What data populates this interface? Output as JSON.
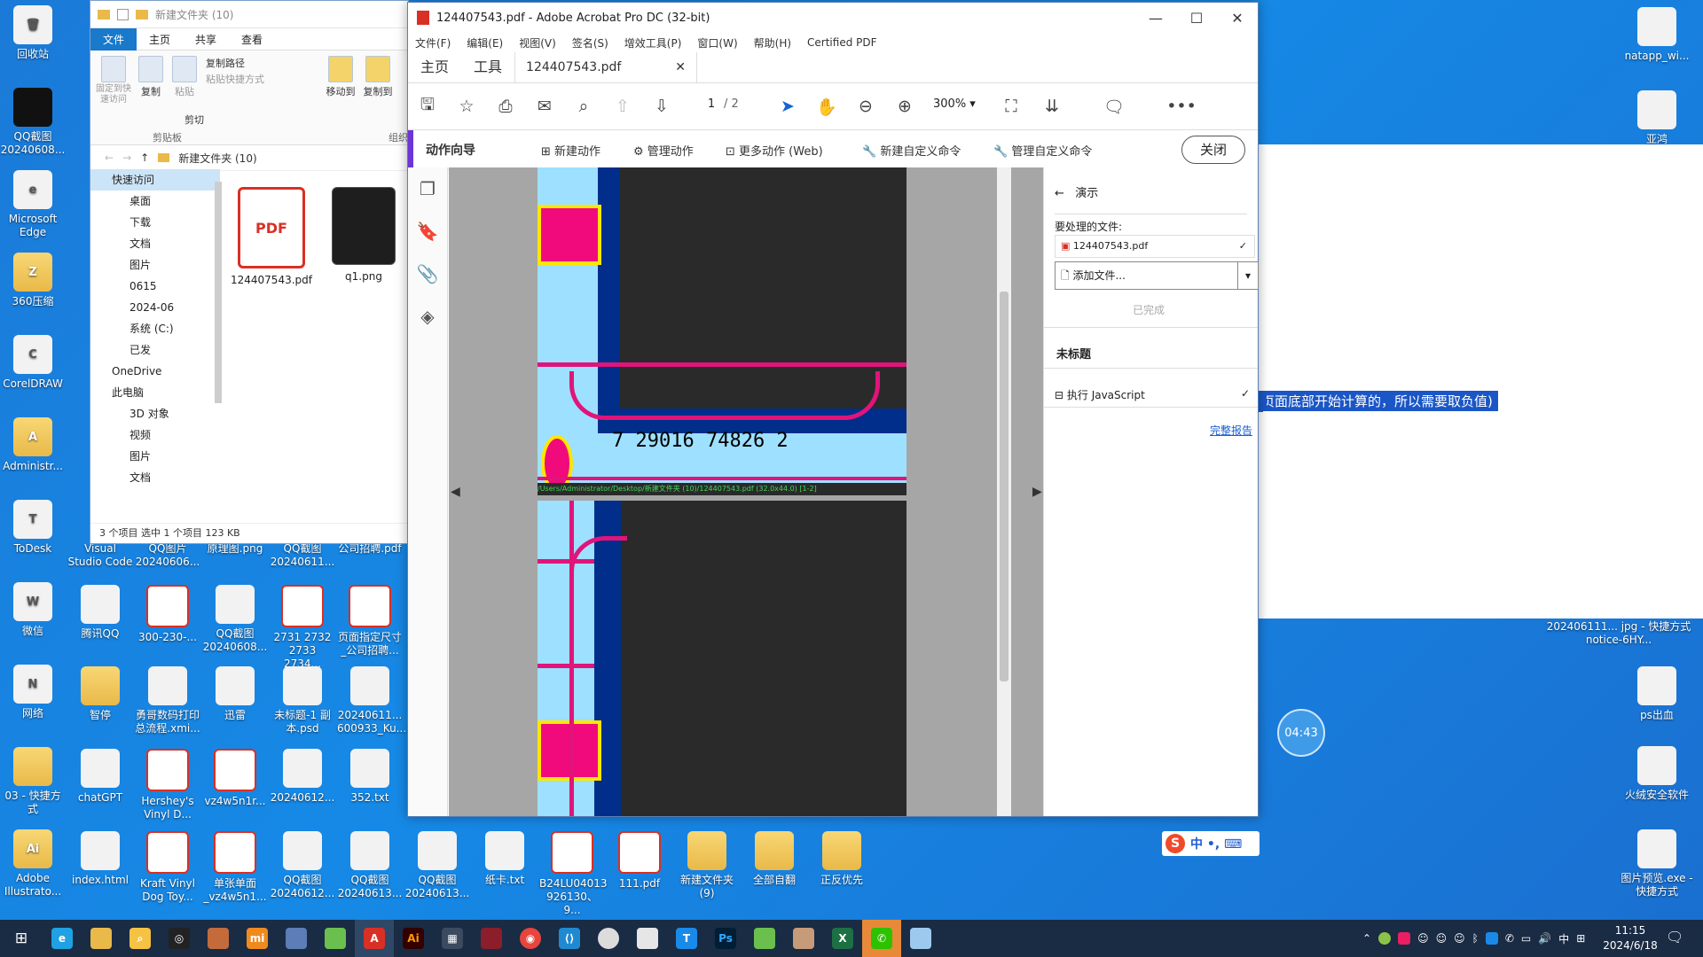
{
  "explorer": {
    "title": "新建文件夹 (10)",
    "tabs": [
      "文件",
      "主页",
      "共享",
      "查看"
    ],
    "ribbon": {
      "pin_label": "固定到快速访问",
      "copy_label": "复制",
      "paste_label": "粘贴",
      "copy_path": "复制路径",
      "paste_shortcut": "粘贴快捷方式",
      "cut": "剪切",
      "clipboard_group": "剪贴板",
      "move_to": "移动到",
      "copy_to": "复制到",
      "organize_group": "组织"
    },
    "path": "新建文件夹 (10)",
    "nav": [
      {
        "label": "快速访问",
        "type": "head"
      },
      {
        "label": "桌面",
        "type": "sub"
      },
      {
        "label": "下载",
        "type": "sub"
      },
      {
        "label": "文档",
        "type": "sub"
      },
      {
        "label": "图片",
        "type": "sub"
      },
      {
        "label": "0615",
        "type": "sub"
      },
      {
        "label": "2024-06",
        "type": "sub"
      },
      {
        "label": "系统 (C:)",
        "type": "sub"
      },
      {
        "label": "已发",
        "type": "sub"
      },
      {
        "label": "OneDrive",
        "type": "head"
      },
      {
        "label": "此电脑",
        "type": "head"
      },
      {
        "label": "3D 对象",
        "type": "sub"
      },
      {
        "label": "视频",
        "type": "sub"
      },
      {
        "label": "图片",
        "type": "sub"
      },
      {
        "label": "文档",
        "type": "sub"
      }
    ],
    "files": [
      {
        "name": "124407543.pdf",
        "icon": "pdf-icon",
        "glyph": "PDF"
      },
      {
        "name": "q1.png",
        "icon": "image-icon",
        "glyph": ""
      }
    ],
    "status": "3 个项目     选中 1 个项目  123 KB"
  },
  "acrobat": {
    "title": "124407543.pdf - Adobe Acrobat Pro DC (32-bit)",
    "menu": [
      "文件(F)",
      "编辑(E)",
      "视图(V)",
      "签名(S)",
      "增效工具(P)",
      "窗口(W)",
      "帮助(H)",
      "Certified PDF"
    ],
    "tabs": {
      "home": "主页",
      "tools": "工具",
      "doc": "124407543.pdf"
    },
    "page_current": "1",
    "page_total": "/ 2",
    "zoom": "300%",
    "action_bar": {
      "title": "动作向导",
      "new_action": "新建动作",
      "manage_action": "管理动作",
      "more_actions": "更多动作 (Web)",
      "new_command": "新建自定义命令",
      "manage_command": "管理自定义命令",
      "close": "关闭"
    },
    "page_footer": "/Users/Administrator/Desktop/新建文件夹 (10)/124407543.pdf (32.0x44.0) [1-2]",
    "barcode_text": "7 29016 74826 2",
    "panel": {
      "back_label": "演示",
      "files_label": "要处理的文件:",
      "file_name": "124407543.pdf",
      "add_file": "添加文件...",
      "done": "已完成",
      "untitled": "未标题",
      "step": "执行 JavaScript",
      "full_report": "完整报告"
    }
  },
  "background_text": {
    "highlight": "页面底部开始计算的，所以需要取负值)"
  },
  "desktop_left": [
    {
      "label": "回收站",
      "glyph": "🗑",
      "cls": "file-ic"
    },
    {
      "label": "QQ截图20240608...",
      "glyph": "",
      "cls": "dark-ic"
    },
    {
      "label": "Microsoft Edge",
      "glyph": "e",
      "cls": "file-ic"
    },
    {
      "label": "360压缩",
      "glyph": "Z",
      "cls": "folder-ic"
    },
    {
      "label": "CorelDRAW",
      "glyph": "C",
      "cls": "file-ic"
    },
    {
      "label": "Administr...",
      "glyph": "A",
      "cls": "folder-ic"
    },
    {
      "label": "ToDesk",
      "glyph": "T",
      "cls": "file-ic"
    },
    {
      "label": "微信",
      "glyph": "W",
      "cls": "file-ic"
    },
    {
      "label": "网络",
      "glyph": "N",
      "cls": "file-ic"
    },
    {
      "label": "03 - 快捷方式",
      "glyph": "",
      "cls": "folder-ic"
    },
    {
      "label": "Adobe Illustrato...",
      "glyph": "Ai",
      "cls": "folder-ic"
    }
  ],
  "desktop_bottom": [
    {
      "label": "Visual Studio Code",
      "col": 1,
      "row": 0
    },
    {
      "label": "QQ图片20240606...",
      "col": 2,
      "row": 0
    },
    {
      "label": "原理图.png",
      "col": 3,
      "row": 0
    },
    {
      "label": "QQ截图20240611...",
      "col": 4,
      "row": 0
    },
    {
      "label": "公司招聘.pdf",
      "col": 5,
      "row": 0
    },
    {
      "label": "腾讯QQ",
      "col": 1,
      "row": 1
    },
    {
      "label": "300-230-...",
      "col": 2,
      "row": 1
    },
    {
      "label": "QQ截图20240608...",
      "col": 3,
      "row": 1
    },
    {
      "label": "2731 2732 2733 2734...",
      "col": 4,
      "row": 1
    },
    {
      "label": "页面指定尺寸_公司招聘...",
      "col": 5,
      "row": 1
    },
    {
      "label": "智停",
      "col": 1,
      "row": 2
    },
    {
      "label": "勇哥数码打印总流程.xmi...",
      "col": 2,
      "row": 2
    },
    {
      "label": "迅雷",
      "col": 3,
      "row": 2
    },
    {
      "label": "未标题-1 副本.psd",
      "col": 4,
      "row": 2
    },
    {
      "label": "20240611... 600933_Ku...",
      "col": 5,
      "row": 2
    },
    {
      "label": "chatGPT",
      "col": 1,
      "row": 3
    },
    {
      "label": "Hershey's Vinyl D...",
      "col": 2,
      "row": 3
    },
    {
      "label": "vz4w5n1r...",
      "col": 3,
      "row": 3
    },
    {
      "label": "20240612...",
      "col": 4,
      "row": 3
    },
    {
      "label": "352.txt",
      "col": 5,
      "row": 3
    },
    {
      "label": "index.html",
      "col": 1,
      "row": 4
    },
    {
      "label": "Kraft Vinyl Dog Toy...",
      "col": 2,
      "row": 4
    },
    {
      "label": "单张单面 _vz4w5n1...",
      "col": 3,
      "row": 4
    },
    {
      "label": "QQ截图20240612...",
      "col": 4,
      "row": 4
    },
    {
      "label": "QQ截图20240613...",
      "col": 5,
      "row": 4
    },
    {
      "label": "QQ截图20240613...",
      "col": 6,
      "row": 4
    },
    {
      "label": "纸卡.txt",
      "col": 7,
      "row": 4
    },
    {
      "label": "B24LU04013 926130、9...",
      "col": 8,
      "row": 4
    },
    {
      "label": "111.pdf",
      "col": 9,
      "row": 4
    },
    {
      "label": "新建文件夹 (9)",
      "col": 10,
      "row": 4
    },
    {
      "label": "全部自翻",
      "col": 11,
      "row": 4
    },
    {
      "label": "正反优先",
      "col": 12,
      "row": 4
    }
  ],
  "desktop_right": [
    {
      "label": "natapp_wi..."
    },
    {
      "label": "亚鸿"
    },
    {
      "label": "202406111... jpg - 快捷方式 notice-6HY..."
    },
    {
      "label": "ps出血"
    },
    {
      "label": "火绒安全软件"
    },
    {
      "label": "图片预览.exe - 快捷方式"
    }
  ],
  "timer": "04:43",
  "ime": "中 •, ⌨",
  "taskbar": {
    "time": "11:15",
    "date": "2024/6/18",
    "ime": "中"
  }
}
